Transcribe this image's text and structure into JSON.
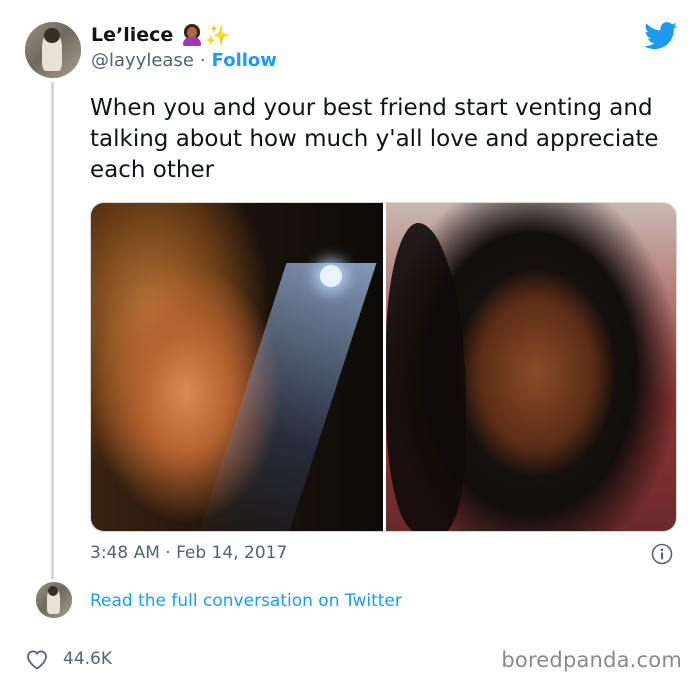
{
  "author": {
    "display_name": "Le’liece",
    "handle": "@layylease",
    "separator": "·",
    "follow_label": "Follow"
  },
  "tweet": {
    "text": "When you and your best friend start venting and talking about how much y'all love and appreciate each other",
    "timestamp": "3:48 AM · Feb 14, 2017"
  },
  "conversation_link": "Read the full conversation on Twitter",
  "engagement": {
    "likes": "44.6K"
  },
  "watermark": "boredpanda.com",
  "icons": {
    "brand": "twitter-bird-icon",
    "info": "info-icon",
    "like": "heart-icon",
    "emoji": [
      "woman-emoji-icon",
      "sparkles-icon"
    ]
  },
  "colors": {
    "accent": "#1d9bf0",
    "secondary_text": "#536471",
    "primary_text": "#0f1419",
    "thread_line": "#cfd9de"
  }
}
